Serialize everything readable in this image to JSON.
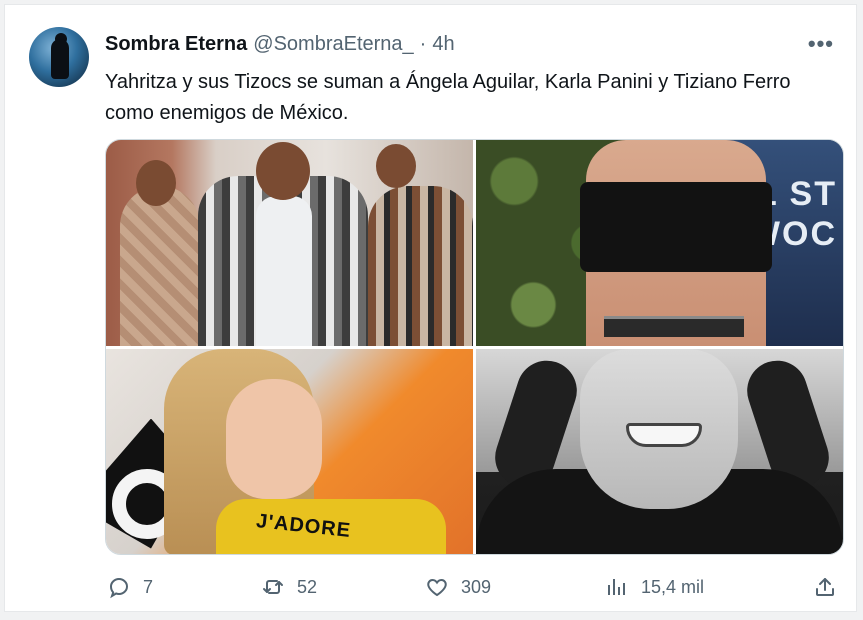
{
  "author": {
    "name": "Sombra Eterna",
    "handle": "@SombraEterna_",
    "separator": "·",
    "time": "4h"
  },
  "more_label": "•••",
  "tweet_text": "Yahritza y sus Tizocs se suman a Ángela Aguilar, Karla Panini y Tiziano Ferro como enemigos de México.",
  "media": {
    "banner_text": "L ST\nWOC",
    "shirt_text": "J'ADORE"
  },
  "actions": {
    "replies": "7",
    "retweets": "52",
    "likes": "309",
    "views": "15,4 mil"
  },
  "icons": {
    "reply": "reply-icon",
    "retweet": "retweet-icon",
    "like": "heart-icon",
    "views": "views-icon",
    "share": "share-icon"
  },
  "colors": {
    "text": "#0f1419",
    "secondary": "#536471",
    "border": "#cfd9de"
  }
}
